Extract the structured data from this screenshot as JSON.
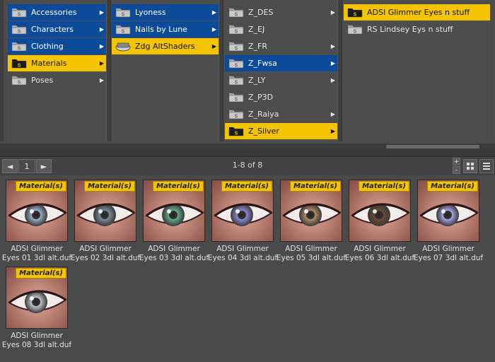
{
  "columns": [
    {
      "items": [
        {
          "label": "Accessories",
          "state": "blue",
          "arrow": true
        },
        {
          "label": "Characters",
          "state": "blue",
          "arrow": true
        },
        {
          "label": "Clothing",
          "state": "blue",
          "arrow": true
        },
        {
          "label": "Materials",
          "state": "gold",
          "arrow": true
        },
        {
          "label": "Poses",
          "state": "plain",
          "arrow": true
        }
      ]
    },
    {
      "items": [
        {
          "label": "Lyoness",
          "state": "blue",
          "arrow": true
        },
        {
          "label": "Nails by Lune",
          "state": "blue",
          "arrow": true
        },
        {
          "label": "Zdg AltShaders",
          "state": "gold",
          "arrow": true
        }
      ]
    },
    {
      "items": [
        {
          "label": "Z_DES",
          "state": "plain",
          "arrow": true
        },
        {
          "label": "Z_EJ",
          "state": "plain",
          "arrow": false
        },
        {
          "label": "Z_FR",
          "state": "plain",
          "arrow": true
        },
        {
          "label": "Z_Fwsa",
          "state": "blue",
          "arrow": true
        },
        {
          "label": "Z_LY",
          "state": "plain",
          "arrow": true
        },
        {
          "label": "Z_P3D",
          "state": "plain",
          "arrow": false
        },
        {
          "label": "Z_Raiya",
          "state": "plain",
          "arrow": true
        },
        {
          "label": "Z_Silver",
          "state": "gold",
          "arrow": true
        }
      ]
    },
    {
      "items": [
        {
          "label": "ADSI Glimmer Eyes n stuff",
          "state": "gold",
          "arrow": false
        },
        {
          "label": "RS Lindsey Eys n stuff",
          "state": "plain",
          "arrow": false
        }
      ]
    }
  ],
  "toolbar": {
    "back_label": "◄",
    "page_number": "1",
    "forward_label": "►",
    "pager_text": "1-8 of 8",
    "plus_label": "+",
    "minus_label": "-"
  },
  "badge_text": "Material(s)",
  "thumbnails": [
    {
      "line1": "ADSI Glimmer",
      "line2": "Eyes 01 3dl alt.duf",
      "iris": "#9ab0c8"
    },
    {
      "line1": "ADSI Glimmer",
      "line2": "Eyes 02 3dl alt.duf",
      "iris": "#7a8a96"
    },
    {
      "line1": "ADSI Glimmer",
      "line2": "Eyes 03 3dl alt.duf",
      "iris": "#5fae8a"
    },
    {
      "line1": "ADSI Glimmer",
      "line2": "Eyes 04 3dl alt.duf",
      "iris": "#8c86d8"
    },
    {
      "line1": "ADSI Glimmer",
      "line2": "Eyes 05 3dl alt.duf",
      "iris": "#b08a60"
    },
    {
      "line1": "ADSI Glimmer",
      "line2": "Eyes 06 3dl alt.duf",
      "iris": "#6a4a32"
    },
    {
      "line1": "ADSI Glimmer",
      "line2": "Eyes 07 3dl alt.duf",
      "iris": "#a8a0e8"
    },
    {
      "line1": "ADSI Glimmer",
      "line2": "Eyes 08 3dl alt.duf",
      "iris": "#c0c4c8"
    }
  ],
  "colors": {
    "selected_blue": "#0b4b99",
    "selected_gold": "#f5c400"
  }
}
